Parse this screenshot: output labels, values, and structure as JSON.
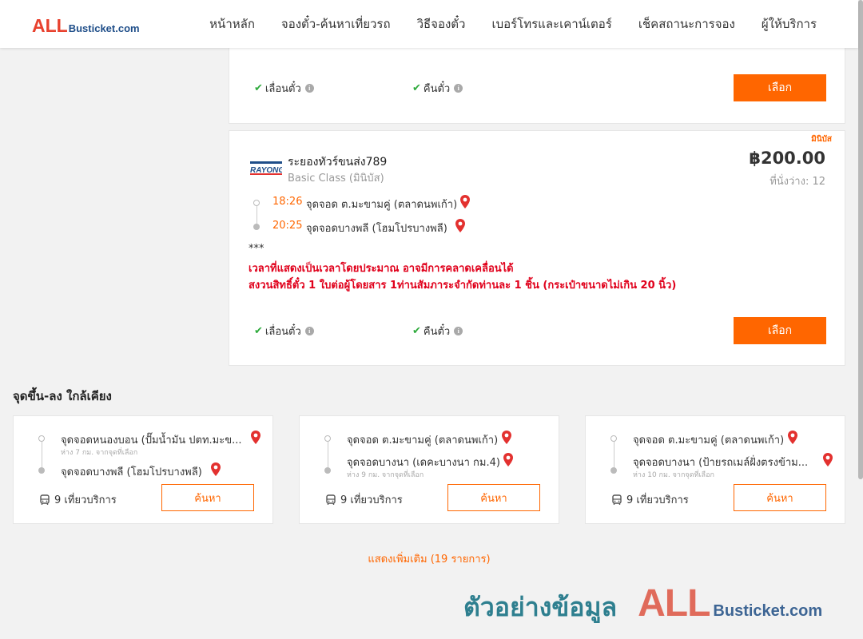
{
  "header": {
    "logo_all": "ALL",
    "logo_rest": "Busticket.com",
    "nav": [
      "หน้าหลัก",
      "จองตั๋ว-ค้นหาเที่ยวรถ",
      "วิธีจองตั๋ว",
      "เบอร์โทรและเคาน์เตอร์",
      "เช็คสถานะการจอง",
      "ผู้ให้บริการ"
    ]
  },
  "top_card": {
    "amenity_1": "เลื่อนตั๋ว",
    "amenity_2": "คืนตั๋ว",
    "select_label": "เลือก"
  },
  "trip": {
    "tag": "มินิบัส",
    "logo_text": "RAYONG",
    "operator": "ระยองทัวร์ขนส่ง789",
    "class": "Basic Class (มินิบัส)",
    "price": "฿200.00",
    "seats": "ที่นั่งว่าง: 12",
    "depart_time": "18:26",
    "depart_stop": "จุดจอด ต.มะขามคู่ (ตลาดนพเก้า)",
    "arrive_time": "20:25",
    "arrive_stop": "จุดจอดบางพลี (โฮมโปรบางพลี)",
    "note_stars": "***",
    "note_line1": "เวลาที่แสดงเป็นเวลาโดยประมาณ อาจมีการคลาดเคลื่อนได้",
    "note_line2": "สงวนสิทธิ์ตั๋ว 1 ใบต่อผู้โดยสาร 1ท่านสัมภาระจำกัดท่านละ 1 ชิ้น (กระเป๋าขนาดไม่เกิน 20 นิ้ว)",
    "amenity_1": "เลื่อนตั๋ว",
    "amenity_2": "คืนตั๋ว",
    "select_label": "เลือก"
  },
  "nearby": {
    "title": "จุดขึ้น-ลง ใกล้เคียง",
    "cards": [
      {
        "from": "จุดจอดหนองบอน (ปั๊มน้ำมัน ปตท.มะข...",
        "from_sub": "ห่าง 7 กม. จากจุดที่เลือก",
        "to": "จุดจอดบางพลี (โฮมโปรบางพลี)",
        "to_sub": "",
        "trips": "9 เที่ยวบริการ",
        "search": "ค้นหา"
      },
      {
        "from": "จุดจอด ต.มะขามคู่ (ตลาดนพเก้า)",
        "from_sub": "",
        "to": "จุดจอดบางนา (เดคะบางนา กม.4)",
        "to_sub": "ห่าง 9 กม. จากจุดที่เลือก",
        "trips": "9 เที่ยวบริการ",
        "search": "ค้นหา"
      },
      {
        "from": "จุดจอด ต.มะขามคู่ (ตลาดนพเก้า)",
        "from_sub": "",
        "to": "จุดจอดบางนา (ป้ายรถเมล์ฝั่งตรงข้าม...",
        "to_sub": "ห่าง 10 กม. จากจุดที่เลือก",
        "trips": "9 เที่ยวบริการ",
        "search": "ค้นหา"
      }
    ]
  },
  "show_more": "แสดงเพิ่มเติม (19 รายการ)",
  "watermark": {
    "text": "ตัวอย่างข้อมูล",
    "all": "ALL",
    "rest": "Busticket.com"
  },
  "icons": {
    "check": "check-icon",
    "info": "info-icon",
    "pin": "location-pin-icon",
    "bus": "bus-icon"
  },
  "colors": {
    "accent": "#ff6600",
    "check": "#2eaa3c",
    "warning": "#e0001b",
    "pin": "#e3312f"
  }
}
